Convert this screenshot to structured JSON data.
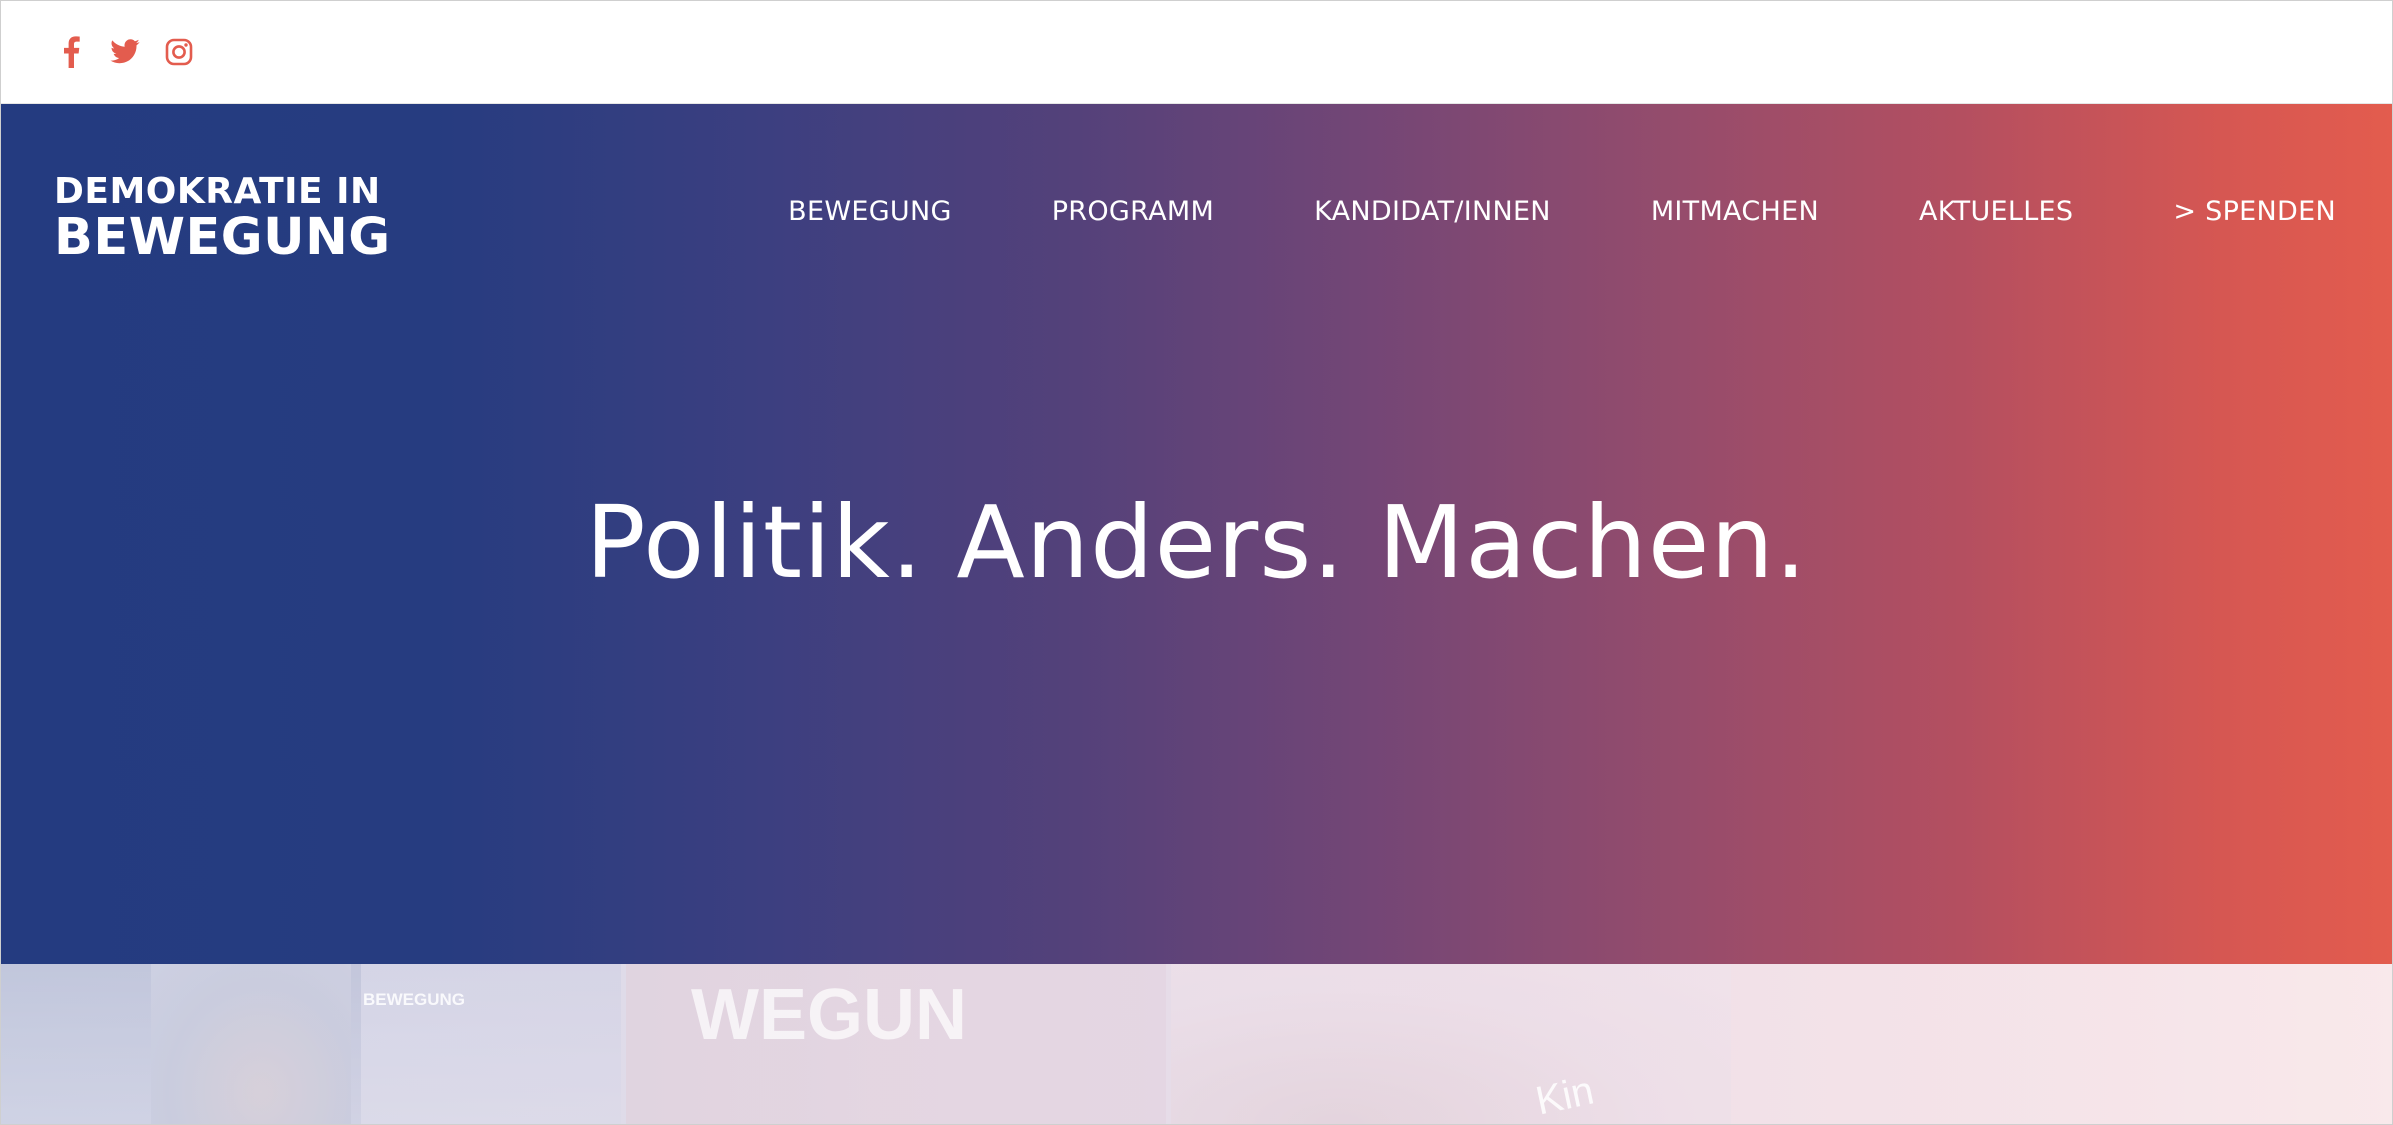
{
  "social": {
    "icons": [
      "facebook-icon",
      "twitter-icon",
      "instagram-icon"
    ],
    "color": "#e35c4e"
  },
  "logo": {
    "line1": "DEMOKRATIE IN",
    "line2": "BEWEGUNG"
  },
  "nav": {
    "items": [
      {
        "label": "BEWEGUNG"
      },
      {
        "label": "PROGRAMM"
      },
      {
        "label": "KANDIDAT/INNEN"
      },
      {
        "label": "MITMACHEN"
      },
      {
        "label": "AKTUELLES"
      },
      {
        "label": "> SPENDEN"
      }
    ]
  },
  "hero": {
    "headline": "Politik. Anders. Machen.",
    "gradient_start": "#243b80",
    "gradient_end": "#e35c4e"
  },
  "photo_strip": {
    "signs": [
      "BEWEGUNG",
      "WEGUN",
      "Kin"
    ]
  }
}
